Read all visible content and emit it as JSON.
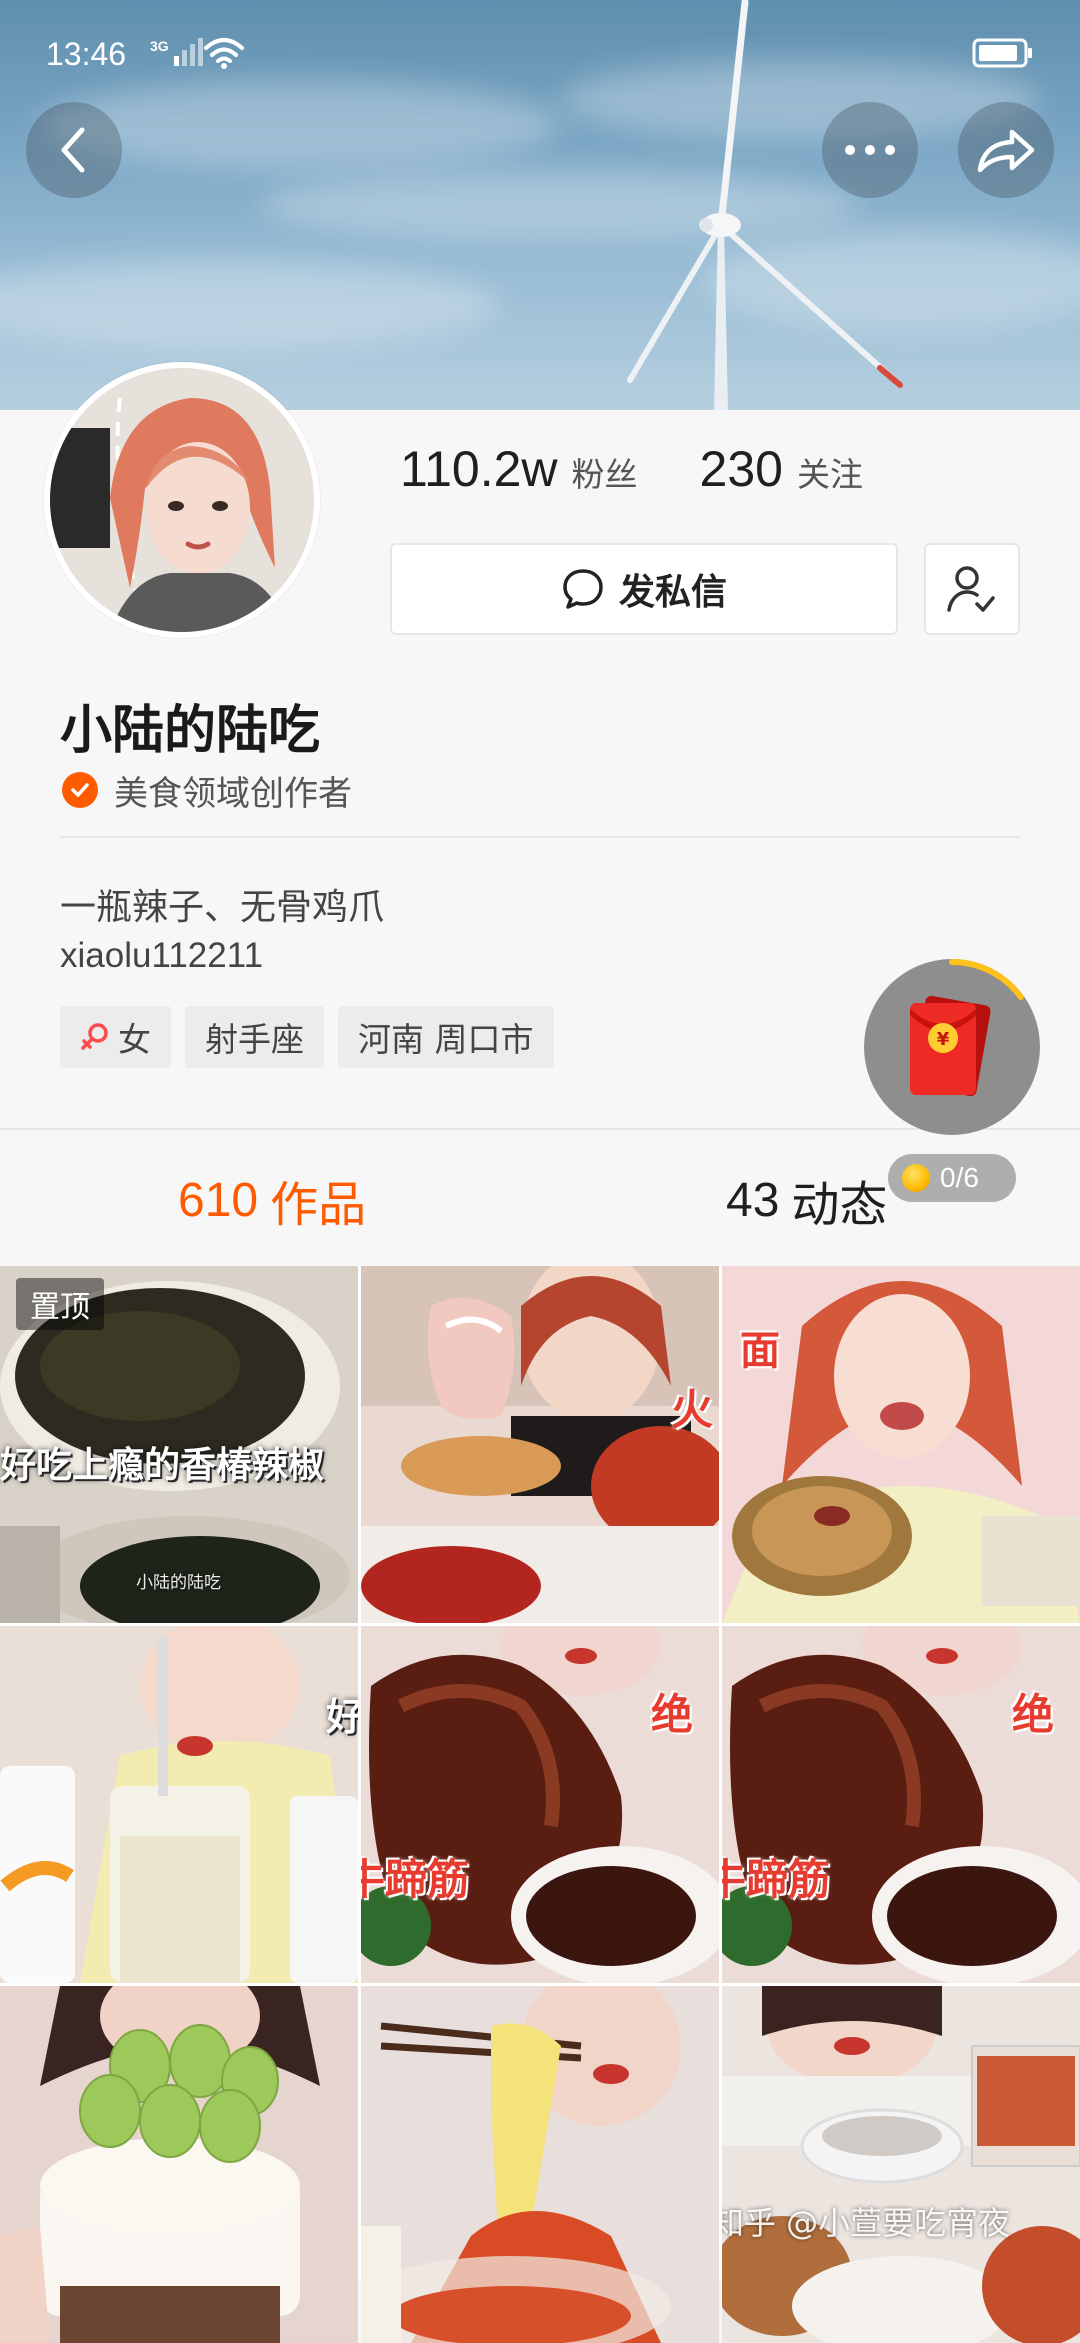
{
  "status_bar": {
    "time": "13:46",
    "network": "3G"
  },
  "profile": {
    "fans_count": "110.2w",
    "fans_label": "粉丝",
    "following_count": "230",
    "following_label": "关注",
    "message_button": "发私信",
    "name": "小陆的陆吃",
    "certification": "美食领域创作者",
    "bio": "一瓶辣子、无骨鸡爪",
    "user_id": "xiaolu112211",
    "tags": [
      "女",
      "射手座",
      "河南 周口市"
    ]
  },
  "reward": {
    "progress_text": "0/6",
    "progress_fraction": 0.15
  },
  "tabs": {
    "works_count": "610",
    "works_label": "作品",
    "dynamics_count": "43",
    "dynamics_label": "动态"
  },
  "videos": [
    {
      "pinned_label": "置顶",
      "caption": "好吃上瘾的香椿辣椒",
      "overlay": "小陆的陆吃"
    },
    {
      "caption": "火"
    },
    {
      "caption": "面"
    },
    {
      "caption": "好"
    },
    {
      "caption": "绝",
      "caption2": "牛蹄筋"
    },
    {
      "caption": "绝",
      "caption2": "牛蹄筋"
    },
    {
      "caption": ""
    },
    {
      "caption": ""
    },
    {
      "caption": ""
    }
  ],
  "watermark": "知乎 @小萱要吃宵夜",
  "colors": {
    "accent": "#fe5b00",
    "tab_active": "#fe5b00",
    "background": "#f7f7f7"
  }
}
